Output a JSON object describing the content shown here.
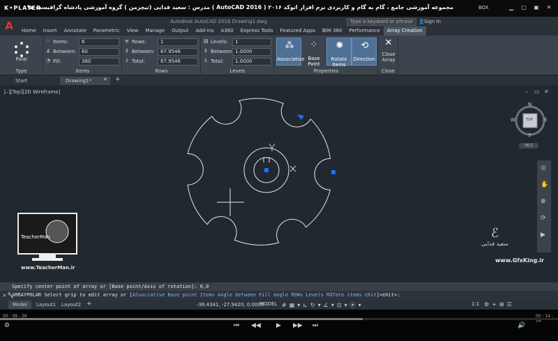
{
  "player": {
    "logo": "K•PLAYER",
    "title": "مجموعه آموزشی جامع ، گام به گام و کاربردی نرم افزار  اتوکد ۲۰۱۶ ( AutoCAD  2016 )  مدرس : سعید فدایی (تیچرمن ) گروه آموزشی پادشاه گرافیست ها",
    "box": "BOX",
    "time_current": "00 : 09 : 26",
    "time_total": "00 : 14 : 34",
    "progress": 0.65
  },
  "acad": {
    "logo": "A",
    "title": "Autodesk AutoCAD 2016    Drawing1.dwg",
    "search_placeholder": "Type a keyword or phrase",
    "sign_in": "Sign In",
    "ribbon_tabs": [
      "Home",
      "Insert",
      "Annotate",
      "Parametric",
      "View",
      "Manage",
      "Output",
      "Add-ins",
      "A360",
      "Express Tools",
      "Featured Apps",
      "BIM 360",
      "Performance",
      "Array Creation"
    ],
    "active_tab": "Array Creation"
  },
  "ribbon": {
    "type": {
      "button": "Polar",
      "label": "Type"
    },
    "items": {
      "label": "Items",
      "items_label": "Items:",
      "items_value": "6",
      "between_label": "Between:",
      "between_value": "60",
      "fill_label": "Fill:",
      "fill_value": "360"
    },
    "rows": {
      "label": "Rows",
      "rows_label": "Rows:",
      "rows_value": "1",
      "between_label": "Between:",
      "between_value": "67.9546",
      "total_label": "Total:",
      "total_value": "67.9546"
    },
    "levels": {
      "label": "Levels",
      "levels_label": "Levels:",
      "levels_value": "1",
      "between_label": "Between:",
      "between_value": "1.0000",
      "total_label": "Total:",
      "total_value": "1.0000"
    },
    "properties": {
      "label": "Properties",
      "associative": "Associative",
      "base_point": "Base Point",
      "rotate_items": "Rotate Items",
      "direction": "Direction"
    },
    "close": {
      "label": "Close",
      "button": "Close Array"
    }
  },
  "doc_tabs": {
    "start": "Start",
    "drawing": "Drawing1*"
  },
  "viewport": {
    "label": "[–][Top][2D Wireframe]"
  },
  "viewcube": {
    "north": "N",
    "south": "S",
    "east": "E",
    "west": "W",
    "top": "TOP",
    "wcs": "WCS"
  },
  "watermark": {
    "name": "TeacherMan",
    "url": "www.TeacherMan.ir",
    "gfx_name": "سعید فدایی",
    "gfx_url": "www.GfxKing.ir"
  },
  "command": {
    "history": "Specify center point of array or [Base point/Axis of rotation]: 0,0",
    "prompt": "ARRAYPOLAR Select grip to edit array or [",
    "options": [
      "ASsociative",
      "Base point",
      "Items",
      "Angle between",
      "Fill angle",
      "ROWs",
      "Levels",
      "ROTate items",
      "eXit"
    ],
    "suffix": "]<eXit>:"
  },
  "status": {
    "tabs": [
      "Model",
      "Layout1",
      "Layout2"
    ],
    "coords": "-36.4341, -27.9420, 0.0000",
    "model": "MODEL",
    "scale": "1:1"
  }
}
